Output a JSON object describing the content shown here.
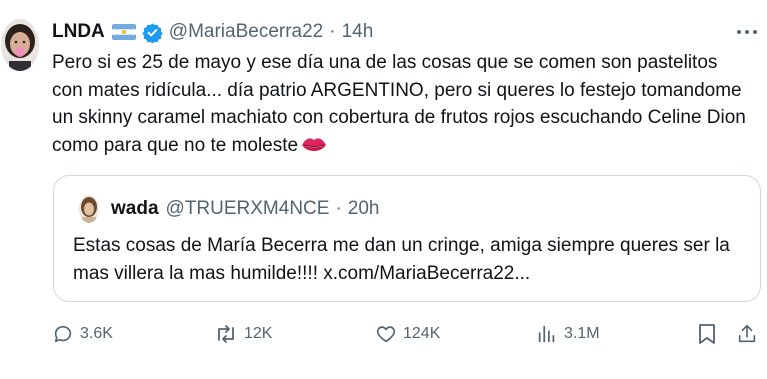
{
  "author": {
    "display_name": "LNDA",
    "handle": "@MariaBecerra22",
    "separator": "·",
    "time": "14h"
  },
  "tweet_text": "Pero si es 25 de mayo y ese día una de las cosas que se comen son pastelitos con mates ridícula... día patrio ARGENTINO, pero si queres lo festejo tomandome un skinny caramel machiato con cobertura de frutos rojos escuchando Celine Dion como para que no te moleste",
  "quoted": {
    "display_name": "wada",
    "handle": "@TRUERXM4NCE",
    "separator": "·",
    "time": "20h",
    "text": "Estas cosas de María Becerra me dan un cringe, amiga siempre queres ser la mas villera la mas humilde!!!! x.com/MariaBecerra22..."
  },
  "actions": {
    "replies": "3.6K",
    "reposts": "12K",
    "likes": "124K",
    "views": "3.1M"
  },
  "icons": {
    "verified": "verified-badge-icon",
    "flag": "argentina-flag-emoji",
    "lips": "kiss-mark-emoji",
    "more": "more-icon",
    "reply": "reply-icon",
    "repost": "repost-icon",
    "like": "like-icon",
    "views": "views-icon",
    "bookmark": "bookmark-icon",
    "share": "share-icon"
  },
  "colors": {
    "text": "#0f1419",
    "secondary": "#536471",
    "verified": "#1d9bf0",
    "border": "#cfd9de",
    "lips": "#e0245e"
  }
}
